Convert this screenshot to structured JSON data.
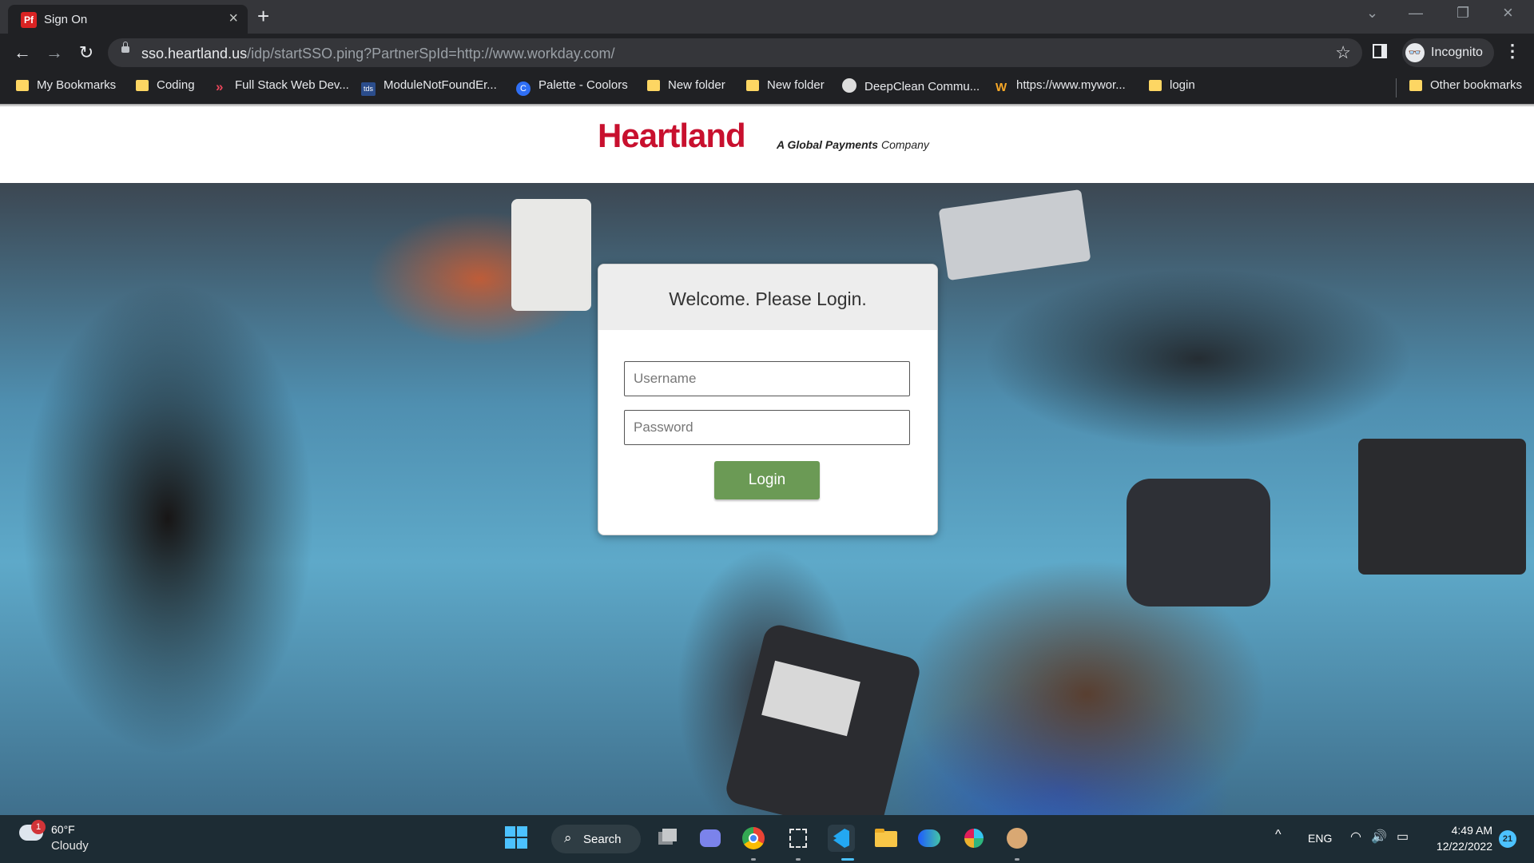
{
  "browser": {
    "tab": {
      "favicon_text": "Pf",
      "title": "Sign On"
    },
    "url": {
      "host": "sso.heartland.us",
      "path": "/idp/startSSO.ping?PartnerSpId=http://www.workday.com/"
    },
    "profile": {
      "label": "Incognito"
    },
    "bookmarks": [
      {
        "label": "My Bookmarks",
        "icon": "folder-icon"
      },
      {
        "label": "Coding",
        "icon": "folder-icon"
      },
      {
        "label": "Full Stack Web Dev...",
        "icon": "fullstack-icon"
      },
      {
        "label": "ModuleNotFoundEr...",
        "icon": "tds-icon"
      },
      {
        "label": "Palette - Coolors",
        "icon": "coolors-icon"
      },
      {
        "label": "New folder",
        "icon": "folder-icon"
      },
      {
        "label": "New folder",
        "icon": "folder-icon"
      },
      {
        "label": "DeepClean Commu...",
        "icon": "deepclean-icon"
      },
      {
        "label": "https://www.mywor...",
        "icon": "workday-icon"
      },
      {
        "label": "login",
        "icon": "folder-icon"
      }
    ],
    "other_bookmarks": "Other bookmarks",
    "icon_glyphs": {
      "close": "×",
      "new_tab": "+",
      "back": "←",
      "forward": "→",
      "reload": "↻",
      "star": "☆",
      "more": "⋮",
      "minimize": "—",
      "restore": "❐",
      "chevron": "⌄",
      "incognito": "👓",
      "fullstack": "»",
      "tds": "tds",
      "coolors": "C",
      "workday": "W"
    }
  },
  "page": {
    "brand": {
      "name": "Heartland",
      "tagline_bold": "A Global Payments",
      "tagline_rest": " Company",
      "color": "#c8102e"
    },
    "login": {
      "title": "Welcome. Please Login.",
      "username_placeholder": "Username",
      "password_placeholder": "Password",
      "button_label": "Login",
      "button_color": "#6b9a55"
    }
  },
  "taskbar": {
    "weather": {
      "badge": "1",
      "temp": "60°F",
      "condition": "Cloudy"
    },
    "search_label": "Search",
    "apps": [
      "task-view-icon",
      "teams-chat-icon",
      "chrome-icon",
      "snipping-tool-icon",
      "vscode-icon",
      "file-explorer-icon",
      "webex-icon",
      "slack-icon",
      "profile-app-icon"
    ],
    "tray": {
      "lang": "ENG",
      "time": "4:49 AM",
      "date": "12/22/2022",
      "notifications": "21"
    },
    "glyphs": {
      "chevron_up": "^",
      "wifi": "◠",
      "volume": "🔊",
      "battery": "▭",
      "search": "⌕"
    }
  }
}
